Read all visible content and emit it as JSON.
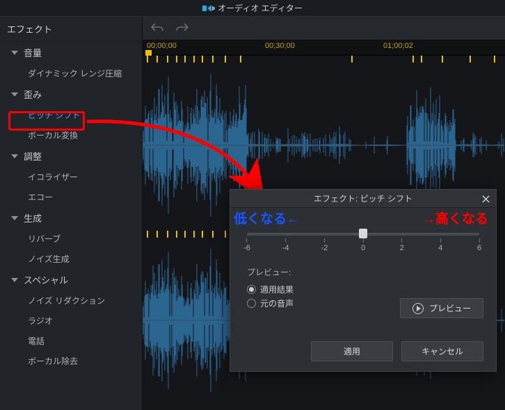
{
  "app": {
    "title": "オーディオ エディター"
  },
  "sidebar": {
    "title": "エフェクト",
    "groups": [
      {
        "label": "音量",
        "items": [
          "ダイナミック レンジ圧縮"
        ]
      },
      {
        "label": "歪み",
        "items": [
          "ピッチ シフト",
          "ボーカル変換"
        ]
      },
      {
        "label": "調整",
        "items": [
          "イコライザー",
          "エコー"
        ]
      },
      {
        "label": "生成",
        "items": [
          "リバーブ",
          "ノイズ生成"
        ]
      },
      {
        "label": "スペシャル",
        "items": [
          "ノイズ リダクション",
          "ラジオ",
          "電話",
          "ボーカル除去"
        ]
      }
    ],
    "selected": "ピッチ シフト"
  },
  "ruler": {
    "ticks": [
      "00;00;00",
      "00;30;00",
      "01;00;02"
    ]
  },
  "dialog": {
    "title": "エフェクト: ピッチ シフト",
    "slider": {
      "min": -6,
      "max": 6,
      "value": 0,
      "ticks": [
        -6,
        -4,
        -2,
        0,
        2,
        4,
        6
      ]
    },
    "preview_label": "プレビュー:",
    "radios": {
      "applied": "適用結果",
      "original": "元の音声",
      "selected": "applied"
    },
    "buttons": {
      "preview": "プレビュー",
      "apply": "適用",
      "cancel": "キャンセル"
    }
  },
  "annotations": {
    "lower": "低くなる←",
    "higher": "→高くなる"
  }
}
